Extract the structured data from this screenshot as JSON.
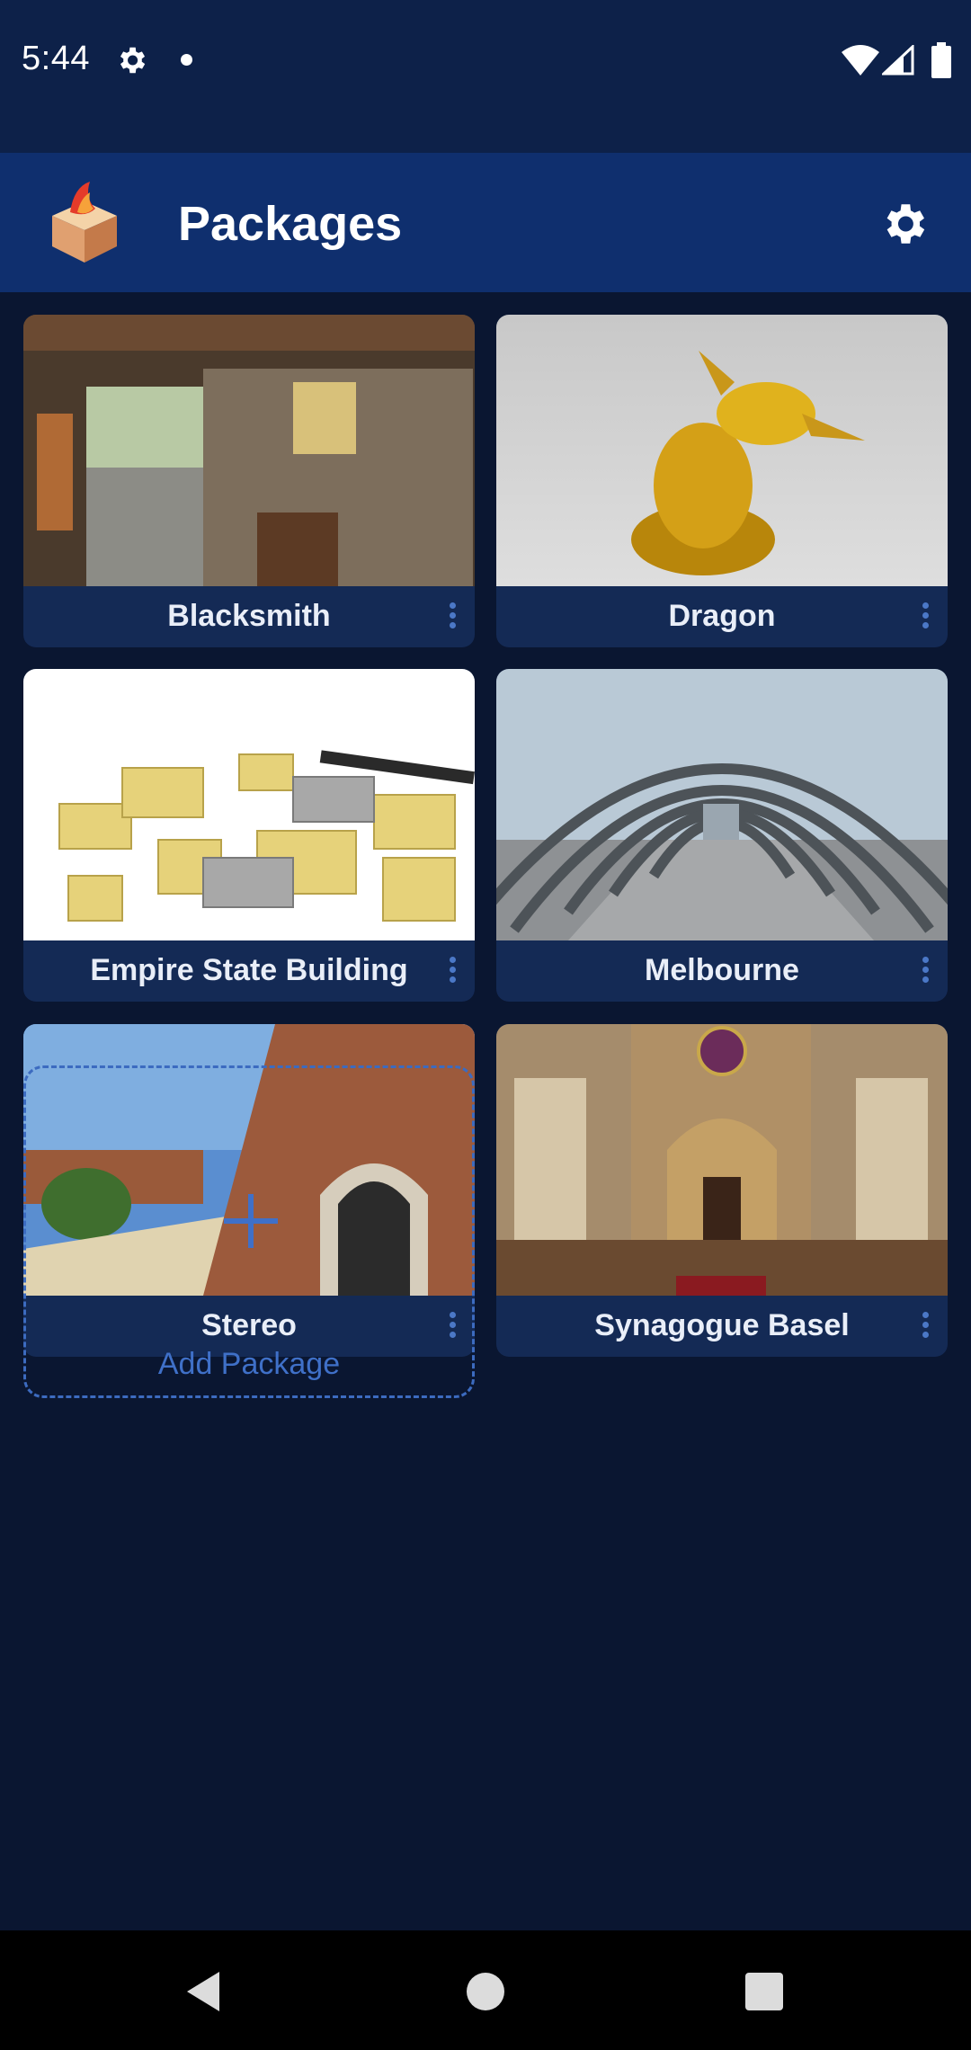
{
  "status_bar": {
    "time": "5:44"
  },
  "app_bar": {
    "title": "Packages"
  },
  "packages": [
    {
      "label": "Blacksmith"
    },
    {
      "label": "Dragon"
    },
    {
      "label": "Empire State Building"
    },
    {
      "label": "Melbourne"
    },
    {
      "label": "Stereo"
    },
    {
      "label": "Synagogue Basel"
    }
  ],
  "add_package": {
    "label": "Add Package"
  },
  "colors": {
    "background": "#0a1631",
    "status_bar": "#0d2149",
    "app_bar": "#0f2f6e",
    "card": "#142a55",
    "accent": "#3f70c8"
  },
  "icons": {
    "status_settings": "gear-icon",
    "app_settings": "gear-icon",
    "card_menu": "more-vertical-icon",
    "add": "plus-icon"
  }
}
